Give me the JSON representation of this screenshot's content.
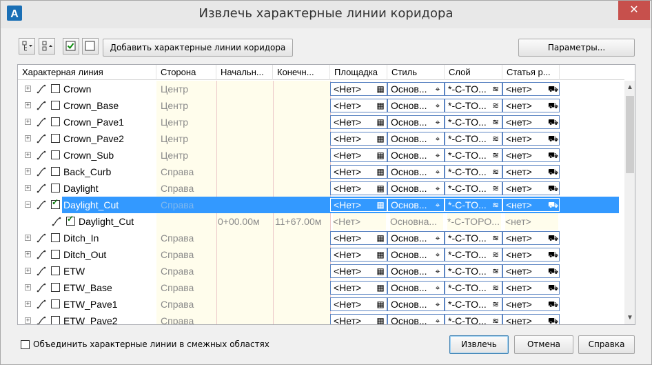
{
  "window": {
    "title": "Извлечь характерные линии коридора",
    "close_glyph": "✕",
    "app_icon": "autocad-icon"
  },
  "toolbar": {
    "expand_icon": "tree-expand-icon",
    "collapse_icon": "tree-collapse-icon",
    "check_all_icon": "check-all-icon",
    "uncheck_all_icon": "uncheck-all-icon",
    "add_button": "Добавить характерные линии коридора",
    "params_button": "Параметры..."
  },
  "grid": {
    "columns": [
      "Характерная линия",
      "Сторона",
      "Начальн...",
      "Конечн...",
      "Площадка",
      "Стиль",
      "Слой",
      "Статья р..."
    ],
    "rows": [
      {
        "name": "Crown",
        "side": "Центр",
        "start": "",
        "end": "",
        "site": "<Нет>",
        "style": "Основ...",
        "layer": "*-C-TO...",
        "item": "<нет>",
        "checked": false,
        "level": 0,
        "selected": false,
        "readonly": false
      },
      {
        "name": "Crown_Base",
        "side": "Центр",
        "start": "",
        "end": "",
        "site": "<Нет>",
        "style": "Основ...",
        "layer": "*-C-TO...",
        "item": "<нет>",
        "checked": false,
        "level": 0,
        "selected": false,
        "readonly": false
      },
      {
        "name": "Crown_Pave1",
        "side": "Центр",
        "start": "",
        "end": "",
        "site": "<Нет>",
        "style": "Основ...",
        "layer": "*-C-TO...",
        "item": "<нет>",
        "checked": false,
        "level": 0,
        "selected": false,
        "readonly": false
      },
      {
        "name": "Crown_Pave2",
        "side": "Центр",
        "start": "",
        "end": "",
        "site": "<Нет>",
        "style": "Основ...",
        "layer": "*-C-TO...",
        "item": "<нет>",
        "checked": false,
        "level": 0,
        "selected": false,
        "readonly": false
      },
      {
        "name": "Crown_Sub",
        "side": "Центр",
        "start": "",
        "end": "",
        "site": "<Нет>",
        "style": "Основ...",
        "layer": "*-C-TO...",
        "item": "<нет>",
        "checked": false,
        "level": 0,
        "selected": false,
        "readonly": false
      },
      {
        "name": "Back_Curb",
        "side": "Справа",
        "start": "",
        "end": "",
        "site": "<Нет>",
        "style": "Основ...",
        "layer": "*-C-TO...",
        "item": "<нет>",
        "checked": false,
        "level": 0,
        "selected": false,
        "readonly": false
      },
      {
        "name": "Daylight",
        "side": "Справа",
        "start": "",
        "end": "",
        "site": "<Нет>",
        "style": "Основ...",
        "layer": "*-C-TO...",
        "item": "<нет>",
        "checked": false,
        "level": 0,
        "selected": false,
        "readonly": false
      },
      {
        "name": "Daylight_Cut",
        "side": "Справа",
        "start": "",
        "end": "",
        "site": "<Нет>",
        "style": "Основ...",
        "layer": "*-C-TO...",
        "item": "<нет>",
        "checked": true,
        "level": 0,
        "selected": true,
        "readonly": false,
        "expanded": true
      },
      {
        "name": "Daylight_Cut",
        "side": "",
        "start": "0+00.00м",
        "end": "11+67.00м",
        "site": "<Нет>",
        "style": "Основна...",
        "layer": "*-C-TOPO...",
        "item": "<нет>",
        "checked": true,
        "level": 1,
        "selected": false,
        "readonly": true
      },
      {
        "name": "Ditch_In",
        "side": "Справа",
        "start": "",
        "end": "",
        "site": "<Нет>",
        "style": "Основ...",
        "layer": "*-C-TO...",
        "item": "<нет>",
        "checked": false,
        "level": 0,
        "selected": false,
        "readonly": false
      },
      {
        "name": "Ditch_Out",
        "side": "Справа",
        "start": "",
        "end": "",
        "site": "<Нет>",
        "style": "Основ...",
        "layer": "*-C-TO...",
        "item": "<нет>",
        "checked": false,
        "level": 0,
        "selected": false,
        "readonly": false
      },
      {
        "name": "ETW",
        "side": "Справа",
        "start": "",
        "end": "",
        "site": "<Нет>",
        "style": "Основ...",
        "layer": "*-C-TO...",
        "item": "<нет>",
        "checked": false,
        "level": 0,
        "selected": false,
        "readonly": false
      },
      {
        "name": "ETW_Base",
        "side": "Справа",
        "start": "",
        "end": "",
        "site": "<Нет>",
        "style": "Основ...",
        "layer": "*-C-TO...",
        "item": "<нет>",
        "checked": false,
        "level": 0,
        "selected": false,
        "readonly": false
      },
      {
        "name": "ETW_Pave1",
        "side": "Справа",
        "start": "",
        "end": "",
        "site": "<Нет>",
        "style": "Основ...",
        "layer": "*-C-TO...",
        "item": "<нет>",
        "checked": false,
        "level": 0,
        "selected": false,
        "readonly": false
      },
      {
        "name": "ETW_Pave2",
        "side": "Справа",
        "start": "",
        "end": "",
        "site": "<Нет>",
        "style": "Основ...",
        "layer": "*-C-TO...",
        "item": "<нет>",
        "checked": false,
        "level": 0,
        "selected": false,
        "readonly": false
      }
    ]
  },
  "footer": {
    "merge_label": "Объединить характерные линии в смежных областях",
    "merge_checked": false,
    "extract_button": "Извлечь",
    "cancel_button": "Отмена",
    "help_button": "Справка"
  },
  "colors": {
    "selection": "#3399ff",
    "close_button": "#c7504c",
    "readonly_bg": "#fffdec"
  }
}
